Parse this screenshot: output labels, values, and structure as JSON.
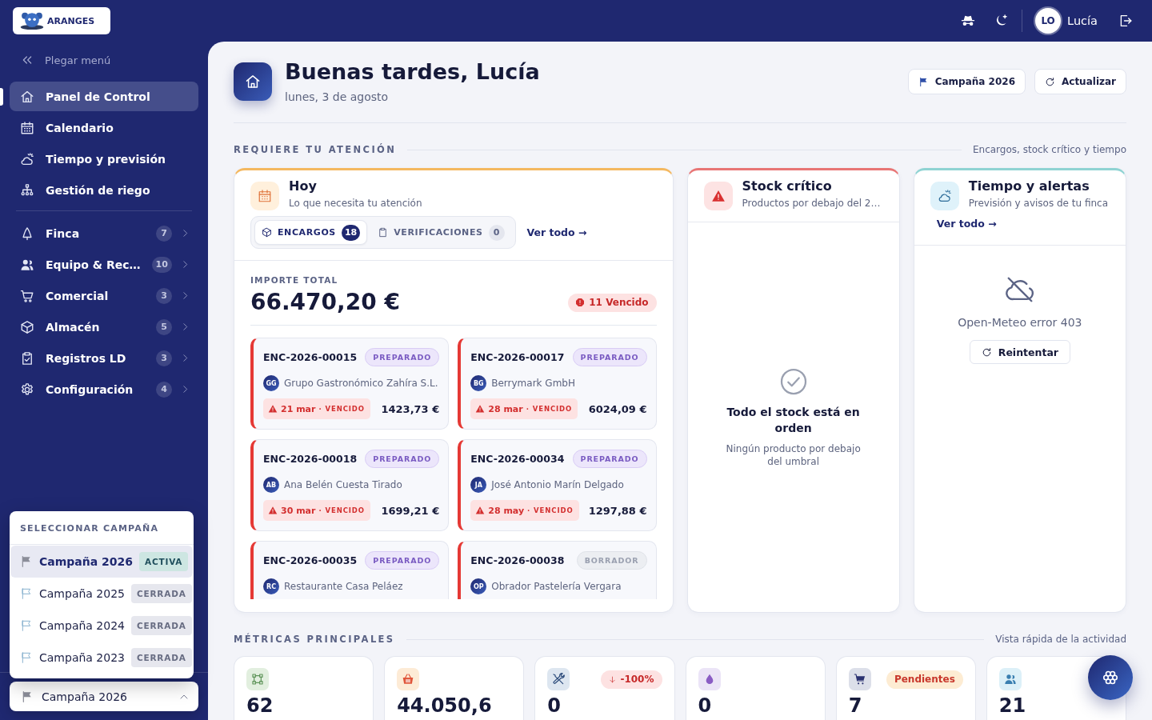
{
  "topbar": {
    "logo_text": "ARANGES",
    "user": {
      "initials": "LO",
      "name": "Lucía"
    }
  },
  "sidebar": {
    "collapse_label": "Plegar menú",
    "primary": [
      {
        "label": "Panel de Control",
        "selected": true
      },
      {
        "label": "Calendario",
        "selected": false
      },
      {
        "label": "Tiempo y previsión",
        "selected": false
      },
      {
        "label": "Gestión de riego",
        "selected": false
      }
    ],
    "sections": [
      {
        "label": "Finca",
        "count": "7",
        "selected": false
      },
      {
        "label": "Equipo & Rec…",
        "count": "10",
        "selected": false
      },
      {
        "label": "Comercial",
        "count": "3",
        "selected": false
      },
      {
        "label": "Almacén",
        "count": "5",
        "selected": false
      },
      {
        "label": "Registros LD",
        "count": "3",
        "selected": false
      },
      {
        "label": "Configuración",
        "count": "4",
        "selected": false
      }
    ],
    "campaign_menu": {
      "title": "SELECCIONAR CAMPAÑA",
      "options": [
        {
          "label": "Campaña 2026",
          "status": "ACTIVA",
          "kind": "active",
          "selected": true
        },
        {
          "label": "Campaña 2025",
          "status": "CERRADA",
          "kind": "closed",
          "selected": false
        },
        {
          "label": "Campaña 2024",
          "status": "CERRADA",
          "kind": "closed",
          "selected": false
        },
        {
          "label": "Campaña 2023",
          "status": "CERRADA",
          "kind": "closed",
          "selected": false
        }
      ]
    },
    "campaign_select": {
      "value": "Campaña 2026",
      "expanded": true
    }
  },
  "header": {
    "title": "Buenas tardes, Lucía",
    "date": "lunes, 3 de agosto",
    "buttons": [
      {
        "label": "Campaña 2026",
        "kind": "campaign"
      },
      {
        "label": "Actualizar",
        "kind": "refresh"
      }
    ]
  },
  "attention": {
    "title": "REQUIERE TU ATENCIÓN",
    "note": "Encargos, stock crítico y tiempo",
    "today": {
      "title": "Hoy",
      "subtitle": "Lo que necesita tu atención",
      "tabs": [
        {
          "label": "ENCARGOS",
          "count": "18",
          "selected": true
        },
        {
          "label": "VERIFICACIONES",
          "count": "0",
          "selected": false
        }
      ],
      "link": "Ver todo →",
      "total_label": "IMPORTE TOTAL",
      "total": "66.470,20 €",
      "overdue": "11 Vencido",
      "orders": [
        {
          "id": "ENC-2026-00015",
          "status": "PREPARADO",
          "kind": "prepared",
          "initials": "GG",
          "customer": "Grupo Gastronómico Zahíra S.L.",
          "overdue": true,
          "due": "21 mar",
          "due_status": "· VENCIDO",
          "amount": "1423,73 €"
        },
        {
          "id": "ENC-2026-00017",
          "status": "PREPARADO",
          "kind": "prepared",
          "initials": "BG",
          "customer": "Berrymark GmbH",
          "overdue": true,
          "due": "28 mar",
          "due_status": "· VENCIDO",
          "amount": "6024,09 €"
        },
        {
          "id": "ENC-2026-00018",
          "status": "PREPARADO",
          "kind": "prepared",
          "initials": "AB",
          "customer": "Ana Belén Cuesta Tirado",
          "overdue": true,
          "due": "30 mar",
          "due_status": "· VENCIDO",
          "amount": "1699,21 €"
        },
        {
          "id": "ENC-2026-00034",
          "status": "PREPARADO",
          "kind": "prepared",
          "initials": "JA",
          "customer": "José Antonio Marín Delgado",
          "overdue": true,
          "due": "28 may",
          "due_status": "· VENCIDO",
          "amount": "1297,88 €"
        },
        {
          "id": "ENC-2026-00035",
          "status": "PREPARADO",
          "kind": "prepared",
          "initials": "RC",
          "customer": "Restaurante Casa Peláez",
          "overdue": true
        },
        {
          "id": "ENC-2026-00038",
          "status": "BORRADOR",
          "kind": "draft",
          "initials": "OP",
          "customer": "Obrador Pastelería Vergara",
          "overdue": true
        }
      ]
    },
    "stock": {
      "title": "Stock crítico",
      "subtitle": "Productos por debajo del 2…",
      "empty_title": "Todo el stock está en orden",
      "empty_text": "Ningún producto por debajo del umbral"
    },
    "weather": {
      "title": "Tiempo y alertas",
      "subtitle": "Previsión y avisos de tu finca",
      "link": "Ver todo →",
      "error": "Open-Meteo error 403",
      "retry": "Reintentar"
    }
  },
  "metrics": {
    "title": "MÉTRICAS PRINCIPALES",
    "note": "Vista rápida de la actividad",
    "items": [
      {
        "value": "62"
      },
      {
        "value": "44.050,6"
      },
      {
        "value": "0",
        "badge": {
          "text": "-100%",
          "kind": "decrease"
        }
      },
      {
        "value": "0"
      },
      {
        "value": "7",
        "badge": {
          "text": "Pendientes",
          "kind": "pending"
        }
      },
      {
        "value": "21"
      }
    ]
  }
}
